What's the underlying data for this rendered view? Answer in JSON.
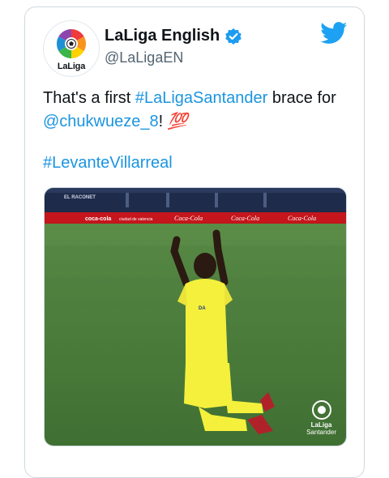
{
  "author": {
    "display_name": "LaLiga English",
    "handle": "@LaLigaEN",
    "avatar_logo_text": "LaLiga",
    "verified_icon": "verified-badge-icon"
  },
  "brand": {
    "app_icon": "twitter-bird-icon",
    "accent_color": "#1b95e0"
  },
  "tweet": {
    "text_part1": "That's a first ",
    "hashtag1": "#LaLigaSantander",
    "text_part2": " brace for ",
    "mention": "@chukwueze_8",
    "text_part3": "! ",
    "emoji": "💯",
    "hashtag2": "#LevanteVillarreal"
  },
  "media": {
    "stadium_sign": "EL RACONET",
    "ad_boards": [
      "coca-cola",
      "ciudad de valencia",
      "Coca-Cola",
      "Coca-Cola",
      "Coca-Cola"
    ],
    "watermark_line1": "LaLiga",
    "watermark_line2": "Santander"
  }
}
